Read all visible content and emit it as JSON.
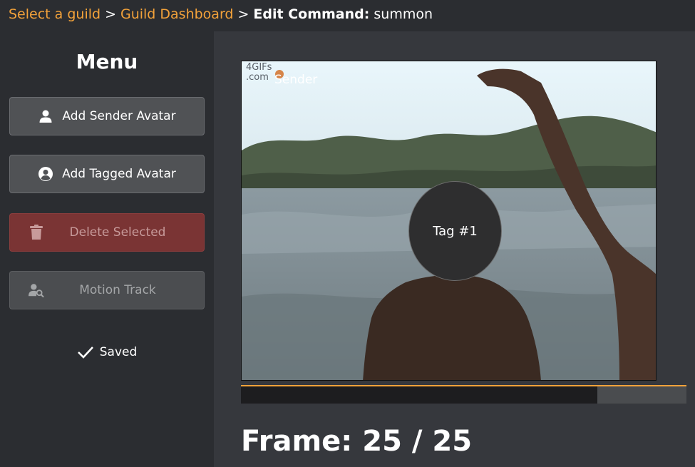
{
  "breadcrumb": {
    "items": [
      "Select a guild",
      "Guild Dashboard"
    ],
    "separator": ">",
    "current_prefix": "Edit Command:",
    "current_value": "summon"
  },
  "sidebar": {
    "title": "Menu",
    "buttons": {
      "add_sender": "Add Sender Avatar",
      "add_tagged": "Add Tagged Avatar",
      "delete": "Delete Selected",
      "motion": "Motion Track"
    },
    "status": "Saved"
  },
  "canvas": {
    "watermark_line1": "4GIFs",
    "watermark_line2": ".com",
    "sender_label": "Sender",
    "tag_label": "Tag #1"
  },
  "timeline": {
    "progress": 0.8
  },
  "frame": {
    "label": "Frame:",
    "current": "25",
    "total": "25"
  },
  "colors": {
    "accent": "#f3a23a",
    "danger": "#7a3434",
    "panel": "#2b2d31"
  }
}
